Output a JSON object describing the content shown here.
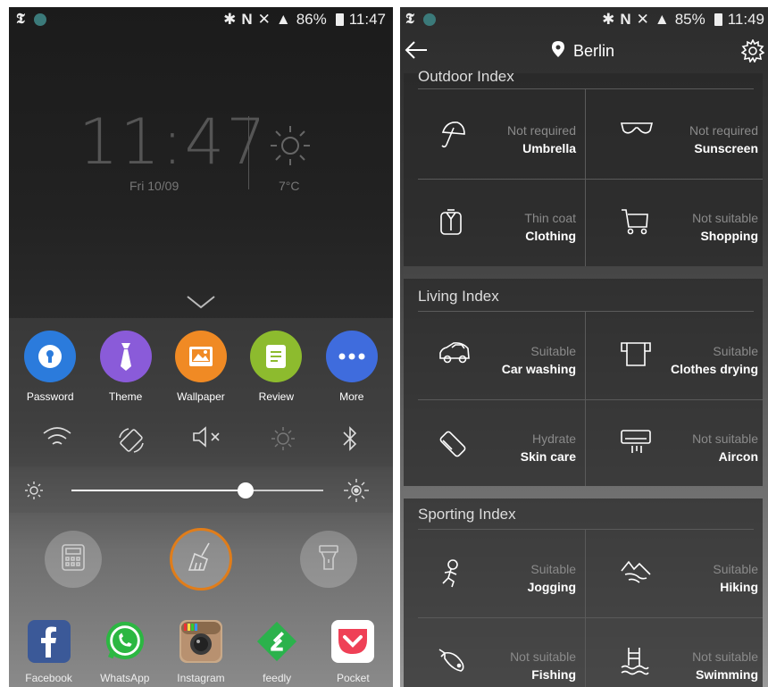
{
  "left_screen": {
    "status": {
      "carrier_icon": "nyt-icon",
      "battery": "86%",
      "time": "11:47"
    },
    "lock": {
      "clock": "11:47",
      "date": "Fri 10/09",
      "temperature": "7°C"
    },
    "quick_apps": [
      {
        "label": "Password",
        "color": "#2b7bdc",
        "icon": "lock-icon"
      },
      {
        "label": "Theme",
        "color": "#8a5bd9",
        "icon": "tie-icon"
      },
      {
        "label": "Wallpaper",
        "color": "#f08a24",
        "icon": "image-icon"
      },
      {
        "label": "Review",
        "color": "#8dbb2e",
        "icon": "note-icon"
      },
      {
        "label": "More",
        "color": "#3f6cdd",
        "icon": "more-icon"
      }
    ],
    "toggles": [
      "wifi-icon",
      "rotation-icon",
      "mute-icon",
      "brightness-icon",
      "bluetooth-icon"
    ],
    "brightness": {
      "level": 0.69
    },
    "tools": [
      "calculator-icon",
      "cleaner-icon",
      "flashlight-icon"
    ],
    "dock": [
      {
        "label": "Facebook",
        "color": "#3b5998"
      },
      {
        "label": "WhatsApp",
        "color": "#2cb742"
      },
      {
        "label": "Instagram",
        "color": "#b89170"
      },
      {
        "label": "feedly",
        "color": "#2bb24c"
      },
      {
        "label": "Pocket",
        "color": "#ef4056"
      }
    ]
  },
  "right_screen": {
    "status": {
      "battery": "85%",
      "time": "11:49"
    },
    "city": "Berlin",
    "sections": [
      {
        "title": "Outdoor Index",
        "items": [
          {
            "status": "Not required",
            "name": "Umbrella",
            "icon": "umbrella-icon"
          },
          {
            "status": "Not required",
            "name": "Sunscreen",
            "icon": "sunglasses-icon"
          },
          {
            "status": "Thin coat",
            "name": "Clothing",
            "icon": "coat-icon"
          },
          {
            "status": "Not suitable",
            "name": "Shopping",
            "icon": "cart-icon"
          }
        ]
      },
      {
        "title": "Living Index",
        "items": [
          {
            "status": "Suitable",
            "name": "Car washing",
            "icon": "car-icon"
          },
          {
            "status": "Suitable",
            "name": "Clothes drying",
            "icon": "shirt-icon"
          },
          {
            "status": "Hydrate",
            "name": "Skin care",
            "icon": "lotion-icon"
          },
          {
            "status": "Not suitable",
            "name": "Aircon",
            "icon": "aircon-icon"
          }
        ]
      },
      {
        "title": "Sporting Index",
        "items": [
          {
            "status": "Suitable",
            "name": "Jogging",
            "icon": "runner-icon"
          },
          {
            "status": "Suitable",
            "name": "Hiking",
            "icon": "mountain-icon"
          },
          {
            "status": "Not suitable",
            "name": "Fishing",
            "icon": "fish-icon"
          },
          {
            "status": "Not suitable",
            "name": "Swimming",
            "icon": "swimmer-icon"
          }
        ]
      }
    ]
  }
}
